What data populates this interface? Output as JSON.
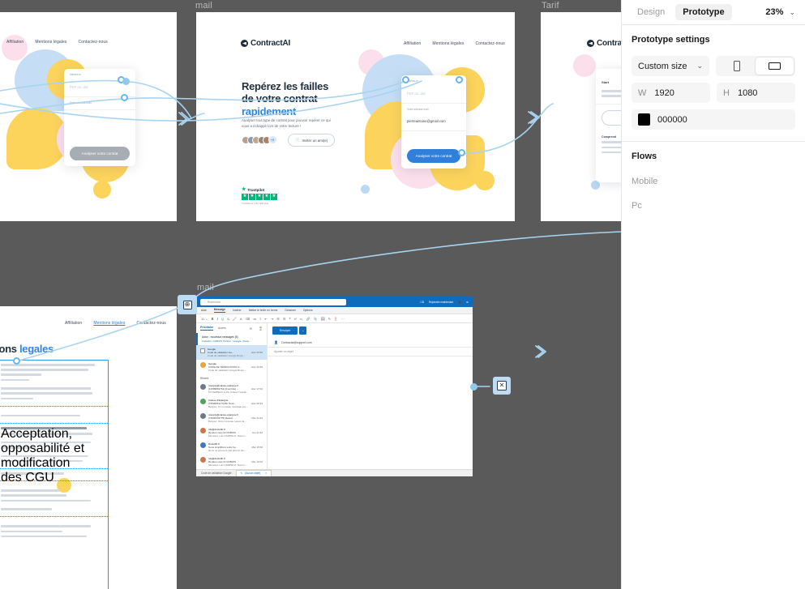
{
  "panel": {
    "tabs": [
      {
        "label": "Design",
        "active": false
      },
      {
        "label": "Prototype",
        "active": true
      }
    ],
    "zoom": "23%",
    "zoom_caret": "⌄",
    "settings_title": "Prototype settings",
    "device_select": {
      "value": "Custom size",
      "caret": "⌄"
    },
    "orientation": {
      "portrait": "portrait-icon",
      "landscape": "landscape-icon",
      "selected": "landscape"
    },
    "width": {
      "key": "W",
      "value": "1920"
    },
    "height": {
      "key": "H",
      "value": "1080"
    },
    "background": {
      "hex": "000000",
      "swatch": "#000000"
    },
    "flows_title": "Flows",
    "flows": [
      {
        "label": "Mobile"
      },
      {
        "label": "Pc"
      }
    ]
  },
  "canvas": {
    "background": "#5a5a5a",
    "connector_color": "#a8d4f0",
    "frames": [
      {
        "name": "frame-home-partial",
        "label": ""
      },
      {
        "name": "frame-mail-landing",
        "label": "mail"
      },
      {
        "name": "frame-tarif",
        "label": "Tarif"
      },
      {
        "name": "frame-mentions-legales",
        "label": ""
      },
      {
        "name": "frame-mail-outlook",
        "label": "mail"
      }
    ]
  },
  "landing": {
    "logo_text": "ContractAI",
    "nav": [
      {
        "label": "Affiliation",
        "active": false
      },
      {
        "label": "Mentions légales",
        "active": false
      },
      {
        "label": "Contactez-nous",
        "active": false
      }
    ],
    "heading_line1": "Repérez les failles",
    "heading_line2": "de votre contrat",
    "heading_accent": "rapidement",
    "paragraph": "Analyser tout type de contrat pour pouvoir repérer ce qui vous a échappé lors de votre lecture !",
    "avatars_more": "+5",
    "invite_label": "Inviter un ami(e)",
    "invite_icon": "document-icon",
    "form": {
      "field1_label": "Insérez-le",
      "field1_value": "PDF ou .doc",
      "field2_label": "Votre adresse mail",
      "field2_value": "pierreantoine@gmail.com",
      "submit_label": "Analyser votre contrat"
    },
    "trustpilot": {
      "star_icon": "★",
      "name": "Trustpilot",
      "stars": 5,
      "subtitle": "TrustScore 4.8 | 908 avis"
    }
  },
  "legal": {
    "nav": [
      {
        "label": "Affiliation",
        "active": false
      },
      {
        "label": "Mentions légales",
        "active": true
      },
      {
        "label": "Contactez-nous",
        "active": false
      }
    ],
    "title_prefix": "Mentions",
    "title_accent": "legales",
    "blocks": [
      {
        "heading": "",
        "lines": 5
      },
      {
        "heading": "",
        "lines": 2
      },
      {
        "heading": "Acceptation, opposabilité et modification des CGU",
        "lines": 5
      },
      {
        "heading": "",
        "lines": 1
      },
      {
        "heading": "",
        "lines": 5
      },
      {
        "heading": "",
        "lines": 3
      }
    ]
  },
  "outlook": {
    "search_icon": "search-icon",
    "search_placeholder": "Rechercher",
    "top_right": [
      {
        "label": "CB"
      },
      {
        "label": "Rejoindre maintenant"
      },
      {
        "label": "video-icon"
      },
      {
        "label": "settings-icon"
      }
    ],
    "ribbon_tabs": [
      {
        "label": "Aide",
        "active": false
      },
      {
        "label": "Message",
        "active": true
      },
      {
        "label": "Insérer",
        "active": false
      },
      {
        "label": "Mettre le texte en forme",
        "active": false
      },
      {
        "label": "Dessiner",
        "active": false
      },
      {
        "label": "Options",
        "active": false
      }
    ],
    "list_header": {
      "focused": "Prioritaire",
      "other": "Autres",
      "icons": "filter-icon"
    },
    "focused_banner": {
      "title": "Avion : nouveaux messages (5)",
      "subtitle": "LinkedIn, GARVIS Vérène : Google, Clara..."
    },
    "sections": [
      {
        "label": "Google"
      },
      {
        "label": "Récent"
      }
    ],
    "messages": [
      {
        "sender": "Google",
        "subject": "Code de validation Ga...",
        "date": "Hier 23:56",
        "preview": "Code de validation Google Bonjo...",
        "selected": true,
        "checkbox": true
      },
      {
        "sender": "Google",
        "subject": "CODE DE VERIFICATION G...",
        "date": "Hier 23:56",
        "preview": "Code de validation Google Bonjo...",
        "selected": false,
        "checkbox": false
      },
      {
        "sender": "noreply@caisse-epargne.fr",
        "subject": "[13399881761] [Contrôle] ...",
        "date": "Hier 17:02",
        "preview": "M CAMPELO LUIS, Utilisez l'espac...",
        "selected": false,
        "checkbox": false
      },
      {
        "sender": "Caisse d'Epargne",
        "subject": "[72500911173] Bh Nouv...",
        "date": "Hier 06:33",
        "preview": "Bonjour, Un nouveau message est...",
        "selected": false,
        "checkbox": false
      },
      {
        "sender": "noreply@caisse-epargne.fr",
        "subject": "[72000043775] Relevé ...",
        "date": "Mar 21:42",
        "preview": "Bonjour, Votre nouveau relevé de ...",
        "selected": false,
        "checkbox": false
      },
      {
        "sender": "rdv@doctolib.fr",
        "subject": "Rendez-vous Dr DUBOIS",
        "date": "Jeu 12:42",
        "preview": "Monsieur Luis CAMPELO, Nous n...",
        "selected": false,
        "checkbox": false
      },
      {
        "sender": "Doctolib.fr",
        "subject": "Nous simplifions votre be...",
        "date": "Mar 15:50",
        "preview": "Nous ne pouvons pas obtenir d'a...",
        "selected": false,
        "checkbox": false
      },
      {
        "sender": "rdv@doctolib.fr",
        "subject": "Rendez-vous Dr DUBOIS",
        "date": "Mer 16:02",
        "preview": "Monsieur Luis CAMPELO, Nous n...",
        "selected": false,
        "checkbox": false
      }
    ],
    "compose": {
      "send_label": "Envoyer",
      "send_caret": "⌄",
      "to_icon": "contact-icon",
      "to_value": "Contractai@support.com",
      "subject_placeholder": "Ajouter un objet",
      "body": ""
    },
    "status": {
      "left": "Code de validation Google",
      "chip_icon": "pencil-icon",
      "chip_label": "(Aucun objet)",
      "chip_close": "×"
    }
  }
}
